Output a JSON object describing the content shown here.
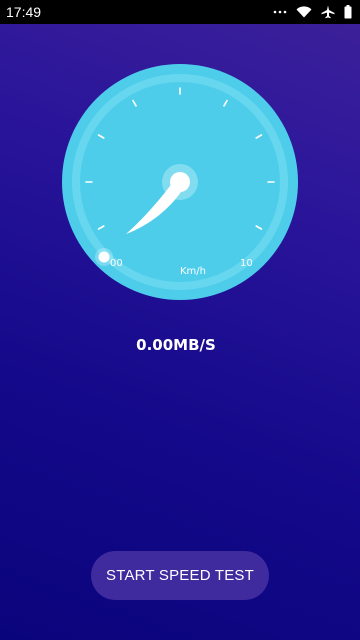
{
  "status_bar": {
    "time": "17:49",
    "icons": [
      "dots-icon",
      "wifi-icon",
      "airplane-icon",
      "battery-icon"
    ]
  },
  "gauge": {
    "min_label": "00",
    "max_label": "10",
    "unit": "Km/h",
    "needle_value": 0,
    "colors": {
      "dial": "#4dcdea",
      "ring": "#6fd9f0",
      "needle": "#ffffff"
    }
  },
  "speed": {
    "readout": "0.00MB/S"
  },
  "actions": {
    "start_label": "START SPEED TEST"
  },
  "theme": {
    "background_top": "#3d2199",
    "background_bottom": "#0a047c",
    "button": "#3f2a9e"
  }
}
